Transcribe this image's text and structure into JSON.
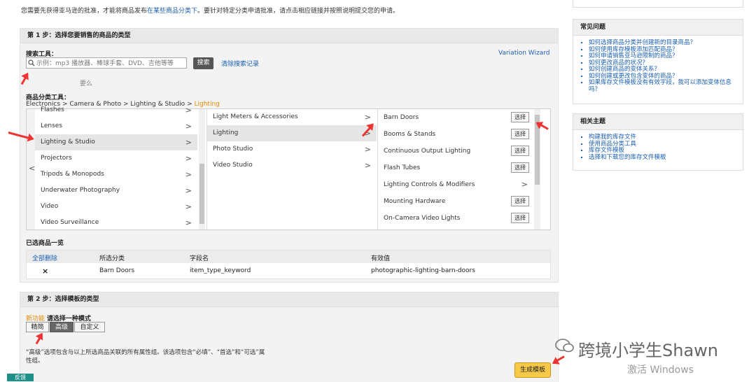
{
  "notice": {
    "text": "您需要先获得亚马逊的批准，才能将商品发布",
    "link": "在某些商品分类下",
    "text2": "。要针对特定分类申请批准，请点击相应链接并按照说明提交您的申请。"
  },
  "step1": {
    "title": "第 1 步：选择您要销售的商品的类型",
    "search_label": "搜索工具：",
    "search_placeholder": "示例：mp3 播放器、棒球手套、DVD、吉他等等",
    "search_button": "搜索",
    "clear_history": "清除搜索记录",
    "variation_wizard": "Variation Wizard",
    "or": "要么",
    "browse_label": "商品分类工具：",
    "breadcrumb": [
      "Electronics",
      "Camera & Photo",
      "Lighting & Studio",
      "Lighting"
    ],
    "breadcrumb_sep": ">",
    "col1": [
      "Flashes",
      "Lenses",
      "Lighting & Studio",
      "Projectors",
      "Tripods & Monopods",
      "Underwater Photography",
      "Video",
      "Video Surveillance"
    ],
    "col2": [
      "Light Meters & Accessories",
      "Lighting",
      "Photo Studio",
      "Video Studio"
    ],
    "col3": [
      {
        "label": "Barn Doors",
        "action": "选择"
      },
      {
        "label": "Booms & Stands",
        "action": "选择"
      },
      {
        "label": "Continuous Output Lighting",
        "action": "选择"
      },
      {
        "label": "Flash Tubes",
        "action": "选择"
      },
      {
        "label": "Lighting Controls & Modifiers",
        "action": ">"
      },
      {
        "label": "Mounting Hardware",
        "action": "选择"
      },
      {
        "label": "On-Camera Video Lights",
        "action": "选择"
      }
    ],
    "chevron": ">",
    "scroll_left": "<"
  },
  "selected": {
    "title": "已选商品一览",
    "headers": [
      "全部删除",
      "所选分类",
      "字段名",
      "有效值"
    ],
    "row": [
      "×",
      "Barn Doors",
      "item_type_keyword",
      "photographic-lighting-barn-doors"
    ]
  },
  "step2": {
    "title": "第 2 步：选择模板的类型",
    "new_feature": "新功能",
    "choose_mode": "请选择一种模式",
    "modes": [
      "精简",
      "高级",
      "自定义"
    ],
    "description": "“高级”选项包含与以上所选商品关联的所有属性组。该选项包含“必填”、“首选”和“可选”属性组。",
    "generate_button": "生成模板"
  },
  "faq": {
    "title": "常见问题",
    "items": [
      "如何选择商品分类并创建新的目录商品？",
      "如何使用库存模板添加匹配商品？",
      "如何申请销售亚马逊限制的商品？",
      "如何更改商品的状况？",
      "如何创建商品的变体关系？",
      "如何创建或更改包含变体的商品？",
      "如果库存文件模板没有有效字段，我可以添加变体信息吗？"
    ]
  },
  "related": {
    "title": "相关主题",
    "items": [
      "构建我的库存文件",
      "使用商品分类工具",
      "库存文件模板",
      "选择和下载您的库存文件模板"
    ]
  },
  "feedback": "反馈",
  "watermark": "跨境小学生Shawn",
  "activate": "激活 Windows",
  "colors": {
    "accent_orange": "#e68a00",
    "link_blue": "#1a5fb4",
    "arrow_red": "#e33333",
    "generate_btn": "#f7c948"
  }
}
